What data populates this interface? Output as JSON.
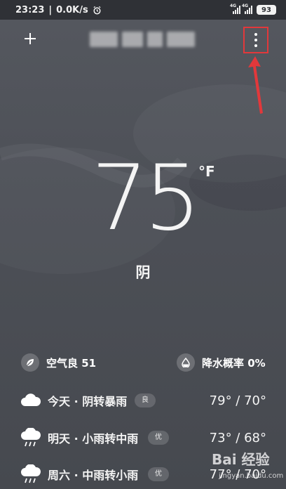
{
  "status_bar": {
    "time": "23:23",
    "net_speed": "0.0K/s",
    "network_tag_1": "4G",
    "network_tag_2": "4G",
    "battery": "93"
  },
  "header": {
    "add_icon": "plus-icon",
    "menu_icon": "more-vertical-icon"
  },
  "current": {
    "temperature": "75",
    "unit": "°F",
    "condition": "阴"
  },
  "stats": {
    "air_quality": "空气良 51",
    "air_icon": "leaf-icon",
    "precipitation": "降水概率 0%",
    "rain_icon": "water-drop-icon"
  },
  "forecast": [
    {
      "label": "今天 · 阴转暴雨",
      "aqi": "良",
      "range": "79° / 70°",
      "icon": "cloud-icon"
    },
    {
      "label": "明天 · 小雨转中雨",
      "aqi": "优",
      "range": "73° / 68°",
      "icon": "rain-icon"
    },
    {
      "label": "周六 · 中雨转小雨",
      "aqi": "优",
      "range": "77° / 70°",
      "icon": "rain-icon"
    }
  ],
  "watermark": {
    "main": "Bai 经验",
    "sub": "jingyan.baidu.com"
  },
  "colors": {
    "annotation_red": "#e2383b",
    "background": "#4d5057"
  }
}
